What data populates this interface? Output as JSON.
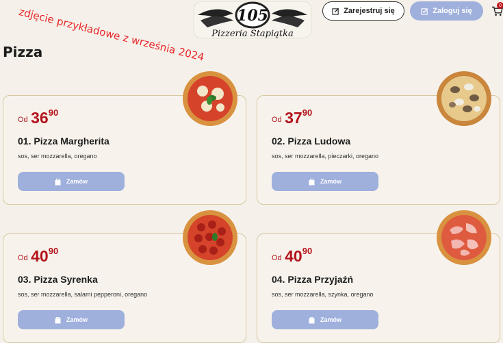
{
  "header": {
    "brand_number": "105",
    "brand_name": "Pizzeria Stapiątka",
    "register_label": "Zarejestruj się",
    "login_label": "Zaloguj się",
    "cart_count": "0"
  },
  "watermark": "zdjęcie przykładowe z września 2024",
  "section_title": "Pizza",
  "price_prefix": "Od",
  "order_label": "Zamów",
  "products": [
    {
      "price_int": "36",
      "price_cents": "90",
      "name": "01. Pizza Margherita",
      "desc": "sos, ser mozzarella, oregano",
      "image": "margherita"
    },
    {
      "price_int": "37",
      "price_cents": "90",
      "name": "02. Pizza Ludowa",
      "desc": "sos, ser mozzarella, pieczarki, oregano",
      "image": "mushroom"
    },
    {
      "price_int": "40",
      "price_cents": "90",
      "name": "03. Pizza Syrenka",
      "desc": "sos, ser mozzarella, salami pepperoni, oregano",
      "image": "pepperoni"
    },
    {
      "price_int": "40",
      "price_cents": "90",
      "name": "04. Pizza Przyjaźń",
      "desc": "sos, ser mozzarella, szynka, oregano",
      "image": "ham"
    }
  ],
  "colors": {
    "accent": "#9fb0dd",
    "price": "#b3141c",
    "card_border": "#d9c7a2",
    "background": "#f5f1ea"
  }
}
